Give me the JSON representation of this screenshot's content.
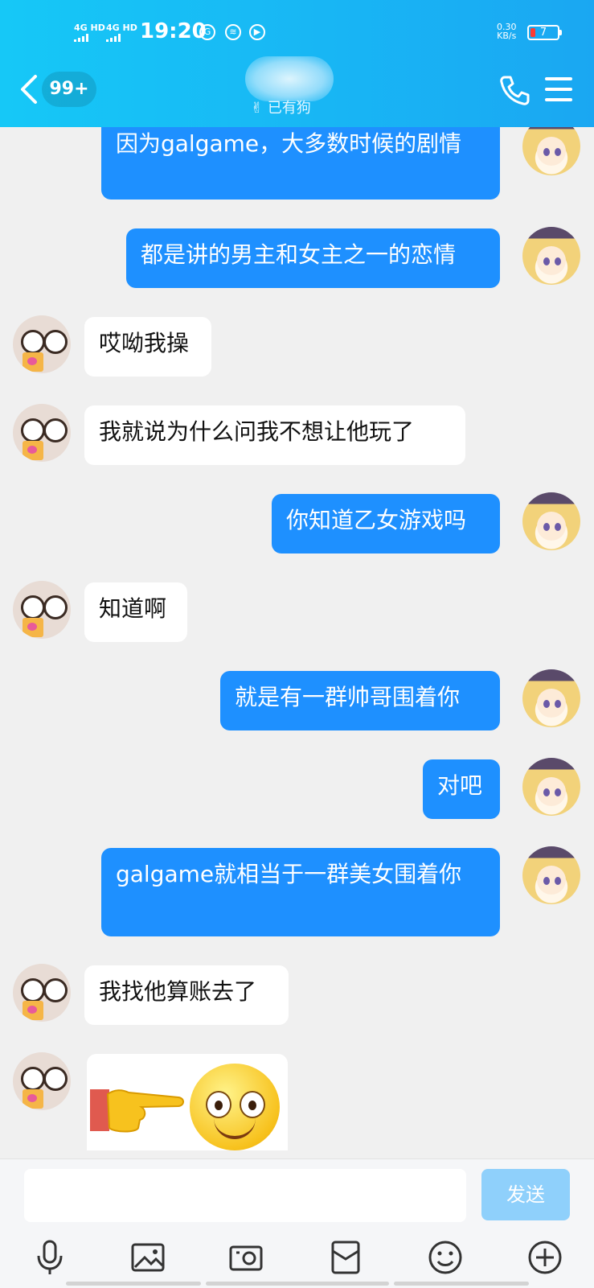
{
  "status_bar": {
    "signal1": "4G HD",
    "signal2": "4G HD",
    "time": "19:20",
    "net_speed_value": "0.30",
    "net_speed_unit": "KB/s",
    "battery": "7"
  },
  "header": {
    "unread_badge": "99+",
    "subtitle": "已有狗",
    "colors": {
      "gradient_start": "#16c8f7",
      "gradient_end": "#1aa7f2"
    }
  },
  "messages": [
    {
      "side": "out",
      "text": "因为galgame，大多数时候的剧情"
    },
    {
      "side": "out",
      "text": "都是讲的男主和女主之一的恋情"
    },
    {
      "side": "in",
      "text": "哎呦我操"
    },
    {
      "side": "in",
      "text": "我就说为什么问我不想让他玩了"
    },
    {
      "side": "out",
      "text": "你知道乙女游戏吗"
    },
    {
      "side": "in",
      "text": "知道啊"
    },
    {
      "side": "out",
      "text": "就是有一群帅哥围着你"
    },
    {
      "side": "out",
      "text": "对吧"
    },
    {
      "side": "out",
      "text": "galgame就相当于一群美女围着你"
    },
    {
      "side": "in",
      "text": "我找他算账去了"
    },
    {
      "side": "in",
      "type": "sticker",
      "icons": [
        "pointing-finger-icon",
        "smiley-face-icon"
      ]
    }
  ],
  "input": {
    "placeholder": "",
    "send_label": "发送"
  },
  "toolbar": {
    "icons": [
      "microphone-icon",
      "image-icon",
      "camera-icon",
      "red-packet-icon",
      "emoji-icon",
      "plus-icon"
    ]
  },
  "colors": {
    "outgoing_bubble": "#1e90ff",
    "incoming_bubble": "#ffffff",
    "background": "#f0f0f0",
    "send_button": "#8fd0fb"
  }
}
